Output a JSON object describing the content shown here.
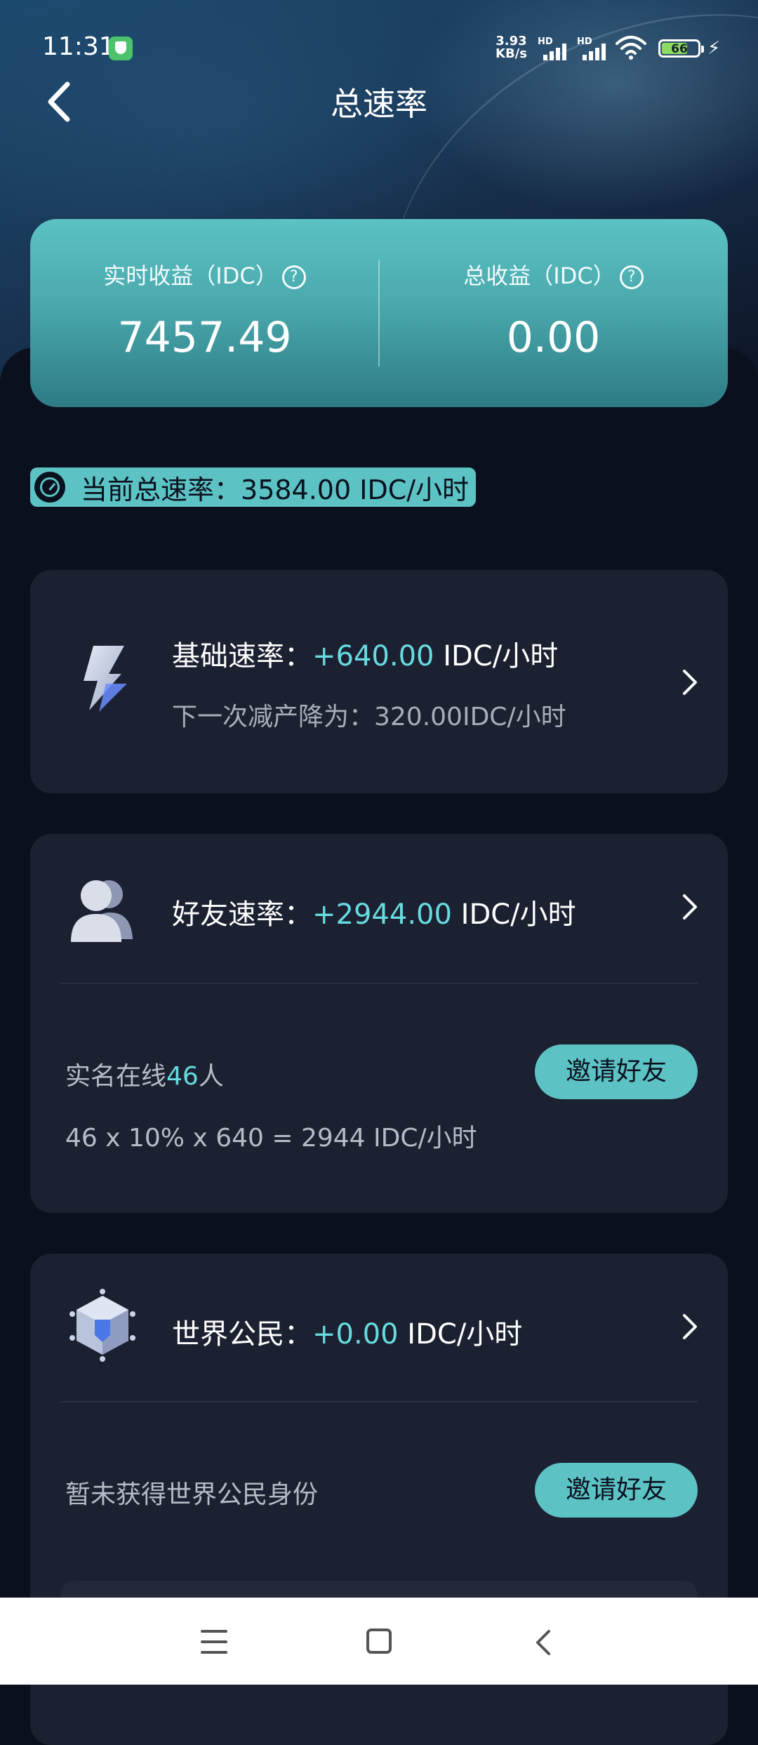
{
  "status_bar": {
    "time": "11:31",
    "net_speed_value": "3.93",
    "net_speed_unit": "KB/s",
    "sim1_label": "HD",
    "sim2_label": "HD",
    "battery": "66"
  },
  "header": {
    "title": "总速率"
  },
  "earnings": {
    "realtime_label": "实时收益（IDC）",
    "realtime_value": "7457.49",
    "total_label": "总收益（IDC）",
    "total_value": "0.00",
    "help_glyph": "?"
  },
  "current_rate": {
    "label": "当前总速率：",
    "value": "3584.00 IDC/小时"
  },
  "base_rate": {
    "label": "基础速率：",
    "value": "+640.00",
    "unit": "IDC/小时",
    "next_reduction": "下一次减产降为：320.00IDC/小时"
  },
  "friend_rate": {
    "label": "好友速率：",
    "value": "+2944.00",
    "unit": "IDC/小时",
    "online_prefix": "实名在线",
    "online_count": "46",
    "online_suffix": "人",
    "formula": "46 x 10% x 640 = 2944 IDC/小时",
    "invite_button": "邀请好友"
  },
  "world_citizen": {
    "label": "世界公民：",
    "value": "+0.00",
    "unit": "IDC/小时",
    "status": "暂未获得世界公民身份",
    "invite_button": "邀请好友"
  },
  "colors": {
    "accent": "#5cc2c4",
    "highlight": "#67dbe0",
    "background": "#0b101e",
    "card": "#1c2131"
  },
  "icons": [
    "shield-icon",
    "signal-icon",
    "wifi-icon",
    "battery-icon",
    "back-icon",
    "help-icon",
    "gauge-icon",
    "lightning-icon",
    "friends-icon",
    "cube-icon",
    "chevron-right-icon",
    "menu-icon",
    "home-icon",
    "nav-back-icon"
  ]
}
